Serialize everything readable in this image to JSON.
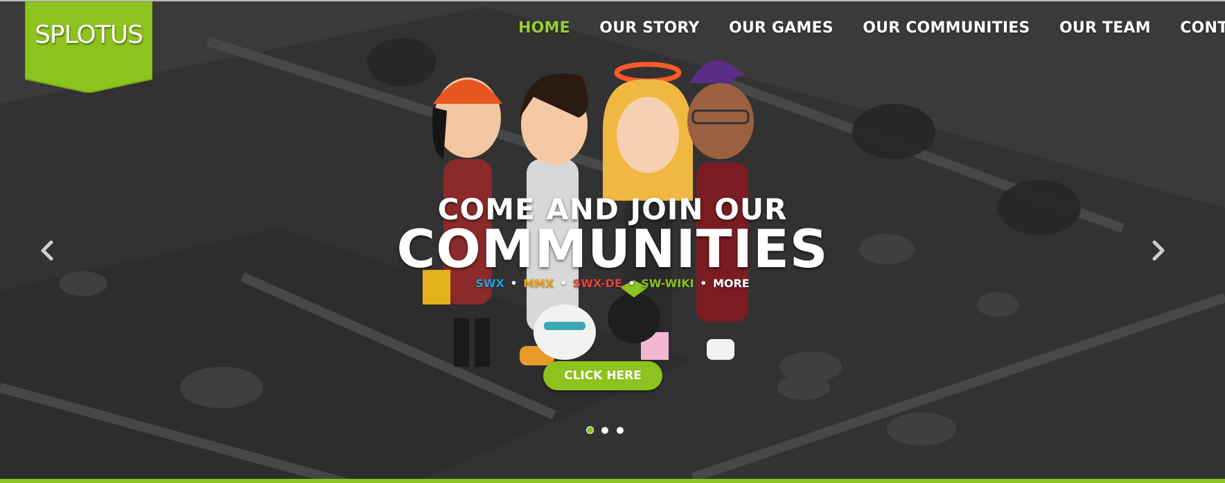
{
  "logo": {
    "text": "SPLOTUS",
    "color": "#8dc21f"
  },
  "nav": {
    "items": [
      {
        "label": "HOME",
        "active": true
      },
      {
        "label": "OUR STORY",
        "active": false
      },
      {
        "label": "OUR GAMES",
        "active": false
      },
      {
        "label": "OUR COMMUNITIES",
        "active": false
      },
      {
        "label": "OUR TEAM",
        "active": false
      },
      {
        "label": "CONTACT U",
        "active": false
      }
    ],
    "active_color": "#9acd32"
  },
  "hero": {
    "line1": "COME AND JOIN OUR",
    "line2": "COMMUNITIES",
    "community_links": [
      {
        "label": "SWX",
        "color": "#1fa2d8"
      },
      {
        "label": "MMX",
        "color": "#f2a516"
      },
      {
        "label": "SWX-DE",
        "color": "#e5433a"
      },
      {
        "label": "SW-WIKI",
        "color": "#8dc21f"
      },
      {
        "label": "MORE",
        "color": "#ffffff"
      }
    ],
    "separator": "•",
    "cta_label": "CLICK HERE",
    "cta_color": "#8dc21f"
  },
  "carousel": {
    "prev_icon": "chevron-left-icon",
    "next_icon": "chevron-right-icon",
    "slide_count": 3,
    "active_slide": 1
  }
}
